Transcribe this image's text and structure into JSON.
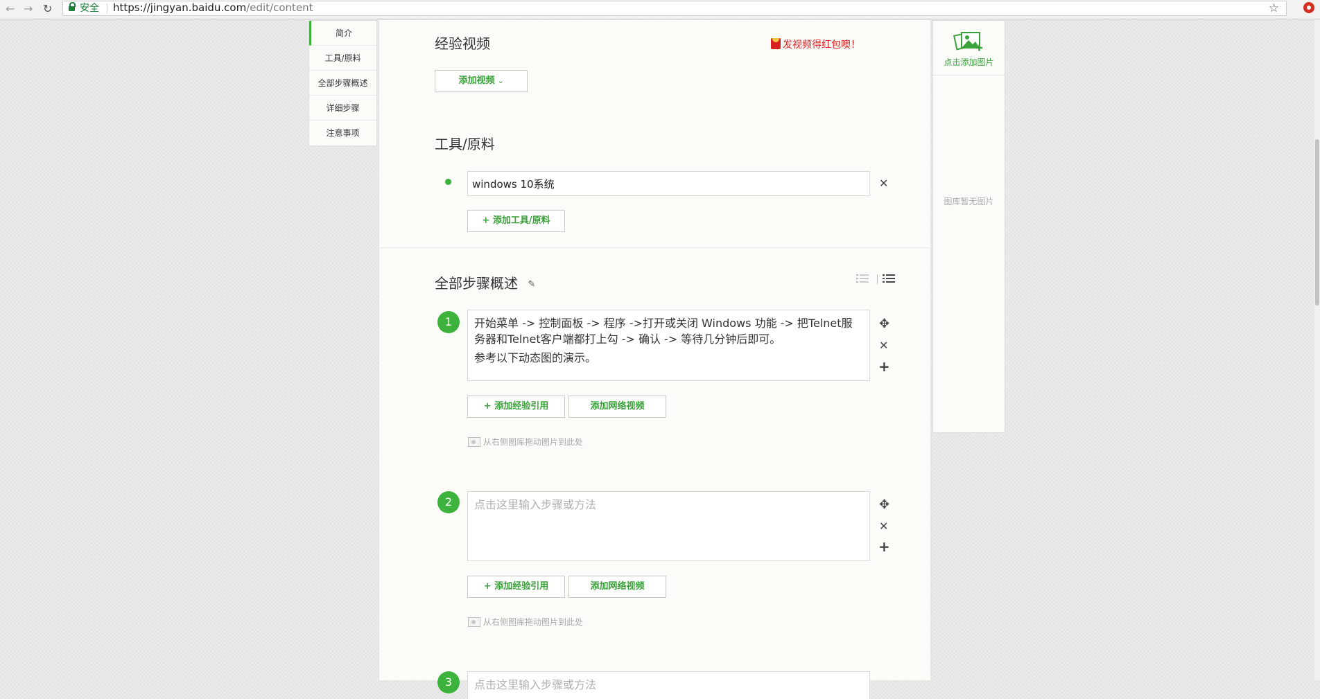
{
  "browser": {
    "security_label": "安全",
    "url_host": "https://jingyan.baidu.com",
    "url_path": "/edit/content"
  },
  "left_nav": {
    "items": [
      {
        "label": "简介"
      },
      {
        "label": "工具/原料"
      },
      {
        "label": "全部步骤概述"
      },
      {
        "label": "详细步骤"
      },
      {
        "label": "注意事项"
      }
    ]
  },
  "video_section": {
    "title": "经验视频",
    "promo": "发视频得红包噢！",
    "add_video_label": "添加视频"
  },
  "tools_section": {
    "title": "工具/原料",
    "items": [
      {
        "value": "windows 10系统"
      }
    ],
    "add_tool_label": "+ 添加工具/原料"
  },
  "steps_section": {
    "title": "全部步骤概述",
    "steps": [
      {
        "number": "1",
        "lines": [
          "开始菜单 -> 控制面板 -> 程序 ->打开或关闭 Windows 功能 -> 把Telnet服务器和Telnet客户端都打上勾 -> 确认 -> 等待几分钟后即可。",
          "参考以下动态图的演示。"
        ],
        "add_ref_label": "+ 添加经验引用",
        "add_video_label": "添加网络视频",
        "drag_hint": "从右侧图库拖动图片到此处"
      },
      {
        "number": "2",
        "placeholder": "点击这里输入步骤或方法",
        "add_ref_label": "+ 添加经验引用",
        "add_video_label": "添加网络视频",
        "drag_hint": "从右侧图库拖动图片到此处"
      },
      {
        "number": "3",
        "placeholder": "点击这里输入步骤或方法"
      }
    ]
  },
  "gallery": {
    "add_label": "点击添加图片",
    "empty_label": "图库暂无图片"
  },
  "colors": {
    "accent_green": "#3cb13c",
    "promo_red": "#e02020"
  }
}
